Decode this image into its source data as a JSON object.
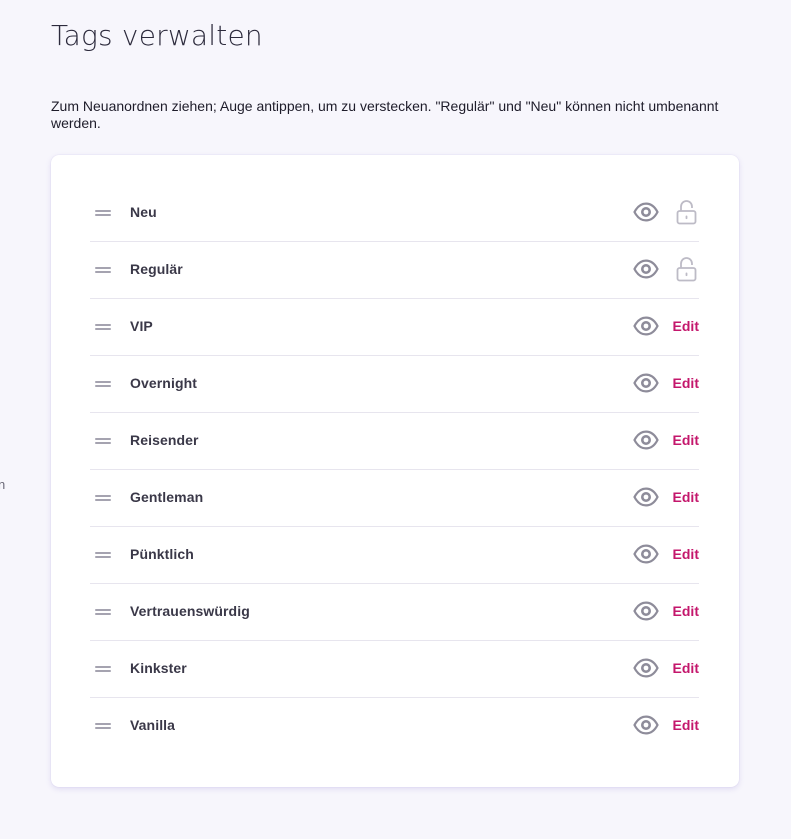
{
  "page": {
    "title": "Tags verwalten",
    "instructions": "Zum Neuanordnen ziehen; Auge antippen, um zu verstecken. \"Regulär\" und \"Neu\" können nicht umbenannt werden.",
    "edge_fragment": "n"
  },
  "icons": {
    "drag": "drag-handle-icon",
    "visibility": "eye-icon",
    "locked": "lock-icon"
  },
  "colors": {
    "accent": "#c4176c",
    "icon": "#8e8c9a",
    "lock": "#bdbbc6",
    "background": "#f7f6fc"
  },
  "tags": [
    {
      "name": "Neu",
      "visible": true,
      "locked": true,
      "action": ""
    },
    {
      "name": "Regulär",
      "visible": true,
      "locked": true,
      "action": ""
    },
    {
      "name": "VIP",
      "visible": true,
      "locked": false,
      "action": "Edit"
    },
    {
      "name": "Overnight",
      "visible": true,
      "locked": false,
      "action": "Edit"
    },
    {
      "name": "Reisender",
      "visible": true,
      "locked": false,
      "action": "Edit"
    },
    {
      "name": "Gentleman",
      "visible": true,
      "locked": false,
      "action": "Edit"
    },
    {
      "name": "Pünktlich",
      "visible": true,
      "locked": false,
      "action": "Edit"
    },
    {
      "name": "Vertrauenswürdig",
      "visible": true,
      "locked": false,
      "action": "Edit"
    },
    {
      "name": "Kinkster",
      "visible": true,
      "locked": false,
      "action": "Edit"
    },
    {
      "name": "Vanilla",
      "visible": true,
      "locked": false,
      "action": "Edit"
    }
  ]
}
